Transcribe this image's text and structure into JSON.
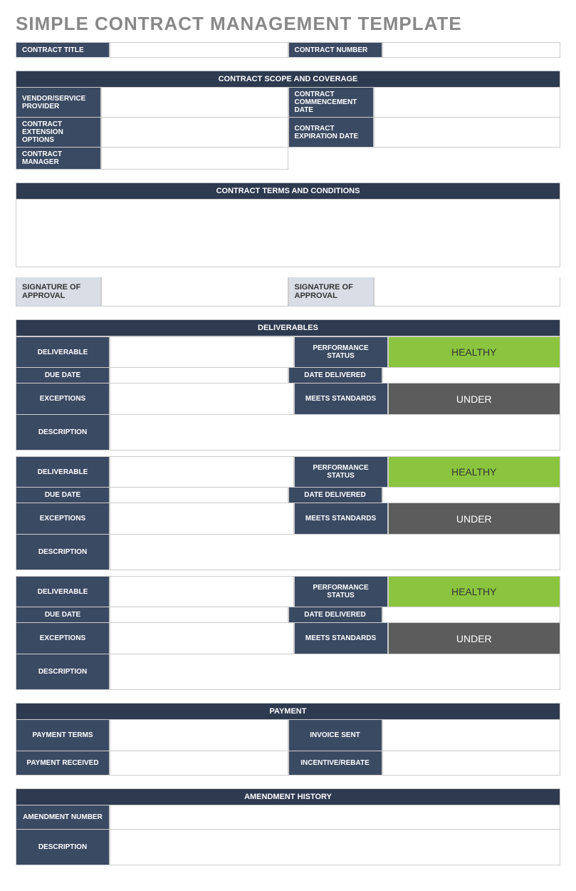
{
  "title": "SIMPLE CONTRACT MANAGEMENT TEMPLATE",
  "header": {
    "contract_title_label": "CONTRACT TITLE",
    "contract_title_value": "",
    "contract_number_label": "CONTRACT NUMBER",
    "contract_number_value": ""
  },
  "scope": {
    "header": "CONTRACT SCOPE AND COVERAGE",
    "vendor_label": "VENDOR/SERVICE PROVIDER",
    "vendor_value": "",
    "commencement_label": "CONTRACT COMMENCEMENT DATE",
    "commencement_value": "",
    "extension_label": "CONTRACT EXTENSION OPTIONS",
    "extension_value": "",
    "expiration_label": "CONTRACT EXPIRATION DATE",
    "expiration_value": "",
    "manager_label": "CONTRACT MANAGER",
    "manager_value": ""
  },
  "terms": {
    "header": "CONTRACT TERMS AND CONDITIONS",
    "body": "",
    "sig1_label": "SIGNATURE OF APPROVAL",
    "sig1_value": "",
    "sig2_label": "SIGNATURE OF APPROVAL",
    "sig2_value": ""
  },
  "deliverables": {
    "header": "DELIVERABLES",
    "labels": {
      "deliverable": "DELIVERABLE",
      "perf_status": "PERFORMANCE STATUS",
      "due_date": "DUE DATE",
      "date_delivered": "DATE DELIVERED",
      "exceptions": "EXCEPTIONS",
      "meets_standards": "MEETS STANDARDS",
      "description": "DESCRIPTION"
    },
    "items": [
      {
        "deliverable": "",
        "perf_status": "HEALTHY",
        "due_date": "",
        "date_delivered": "",
        "exceptions": "",
        "meets_standards": "UNDER",
        "description": ""
      },
      {
        "deliverable": "",
        "perf_status": "HEALTHY",
        "due_date": "",
        "date_delivered": "",
        "exceptions": "",
        "meets_standards": "UNDER",
        "description": ""
      },
      {
        "deliverable": "",
        "perf_status": "HEALTHY",
        "due_date": "",
        "date_delivered": "",
        "exceptions": "",
        "meets_standards": "UNDER",
        "description": ""
      }
    ]
  },
  "payment": {
    "header": "PAYMENT",
    "terms_label": "PAYMENT TERMS",
    "terms_value": "",
    "invoice_label": "INVOICE SENT",
    "invoice_value": "",
    "received_label": "PAYMENT RECEIVED",
    "received_value": "",
    "incentive_label": "INCENTIVE/REBATE",
    "incentive_value": ""
  },
  "amendment": {
    "header": "AMENDMENT HISTORY",
    "number_label": "AMENDMENT NUMBER",
    "number_value": "",
    "description_label": "DESCRIPTION",
    "description_value": ""
  }
}
